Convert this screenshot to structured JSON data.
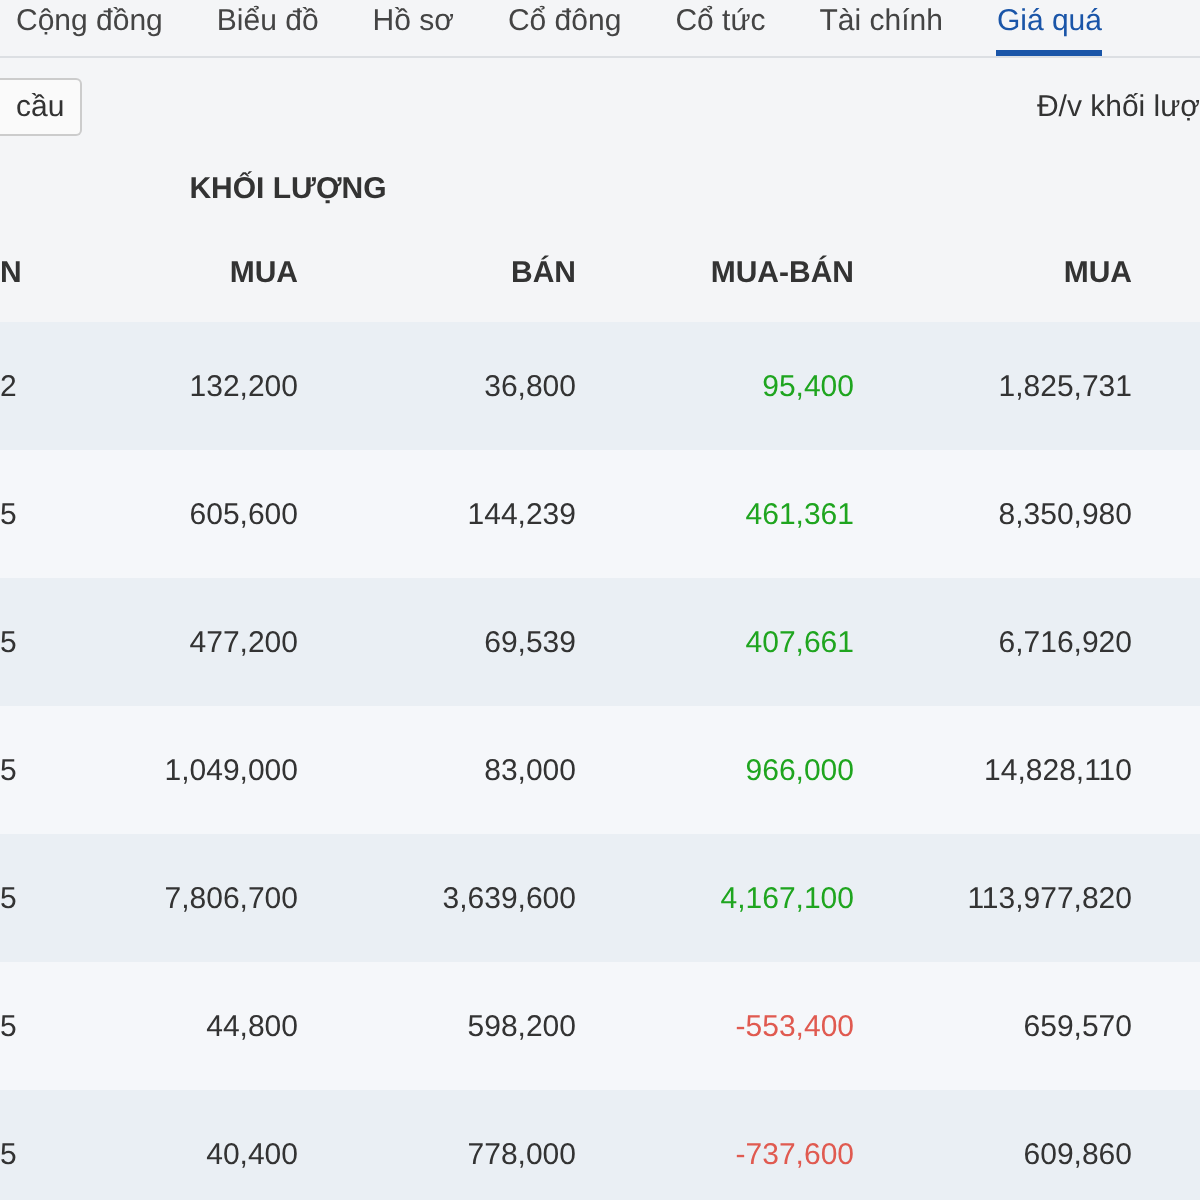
{
  "tabs": [
    {
      "label": "Cộng đồng",
      "selected": false
    },
    {
      "label": "Biểu đồ",
      "selected": false
    },
    {
      "label": "Hồ sơ",
      "selected": false
    },
    {
      "label": "Cổ đông",
      "selected": false
    },
    {
      "label": "Cổ tức",
      "selected": false
    },
    {
      "label": "Tài chính",
      "selected": false
    },
    {
      "label": "Giá quá",
      "selected": true
    }
  ],
  "toolbar": {
    "button": "cầu",
    "unit_note": "Đ/v khối lượ"
  },
  "table": {
    "group_header": "KHỐI LƯỢNG",
    "columns": [
      "N",
      "MUA",
      "BÁN",
      "MUA-BÁN",
      "MUA"
    ],
    "rows": [
      {
        "cells": [
          "2",
          "132,200",
          "36,800",
          "95,400",
          "1,825,731"
        ],
        "negative": false
      },
      {
        "cells": [
          "5",
          "605,600",
          "144,239",
          "461,361",
          "8,350,980"
        ],
        "negative": false
      },
      {
        "cells": [
          "5",
          "477,200",
          "69,539",
          "407,661",
          "6,716,920"
        ],
        "negative": false
      },
      {
        "cells": [
          "5",
          "1,049,000",
          "83,000",
          "966,000",
          "14,828,110"
        ],
        "negative": false
      },
      {
        "cells": [
          "5",
          "7,806,700",
          "3,639,600",
          "4,167,100",
          "113,977,820"
        ],
        "negative": false
      },
      {
        "cells": [
          "5",
          "44,800",
          "598,200",
          "-553,400",
          "659,570"
        ],
        "negative": true
      },
      {
        "cells": [
          "5",
          "40,400",
          "778,000",
          "-737,600",
          "609,860"
        ],
        "negative": true
      }
    ]
  }
}
